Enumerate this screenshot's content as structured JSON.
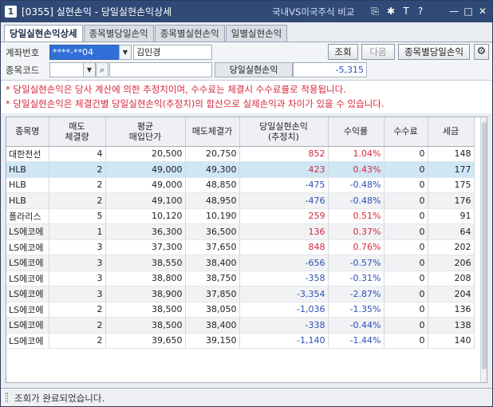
{
  "window": {
    "screen_no": "[0355]",
    "title": "실현손익 - 당일실현손익상세",
    "link": "국내VS미국주식 비교",
    "app_icon": "1"
  },
  "titlebar_icons": [
    "link-icon",
    "pin-icon",
    "font-size-icon",
    "help-icon",
    "minimize-icon",
    "maximize-icon",
    "close-icon"
  ],
  "tabs": [
    {
      "label": "당일실현손익상세",
      "active": true
    },
    {
      "label": "종목별당일손익",
      "active": false
    },
    {
      "label": "종목별실현손익",
      "active": false
    },
    {
      "label": "일별실현손익",
      "active": false
    }
  ],
  "form": {
    "account_label": "계좌번호",
    "account_value": "****-**04",
    "account_name": "김인경",
    "stock_label": "종목코드",
    "stock_value": "",
    "stock_name": "",
    "summary_label": "당일실현손익",
    "summary_value": "-5,315",
    "query_button": "조회",
    "next_button": "다음",
    "stock_daily_button": "종목별당일손익"
  },
  "notes": [
    "* 당일실현손익은 당사 계산에 의한 추정치이며, 수수료는 체결시 수수료률로 적용됩니다.",
    "* 당일실현손익은 체결건별 당일실현손익(추정치)의 합산으로 실제손익과 차이가 있을 수 있습니다."
  ],
  "table": {
    "headers": {
      "name": "종목명",
      "qty_1": "매도",
      "qty_2": "체결량",
      "avg_1": "평균",
      "avg_2": "매입단가",
      "sell_price": "매도체결가",
      "pnl_1": "당일실현손익",
      "pnl_2": "(추정치)",
      "rate": "수익률",
      "fee": "수수료",
      "tax": "세금"
    },
    "rows": [
      {
        "name": "대한전선",
        "qty": "4",
        "avg": "20,500",
        "sell": "20,750",
        "pnl": "852",
        "rate": "1.04%",
        "fee": "0",
        "tax": "148",
        "sign": "pos"
      },
      {
        "name": "HLB",
        "qty": "2",
        "avg": "49,000",
        "sell": "49,300",
        "pnl": "423",
        "rate": "0.43%",
        "fee": "0",
        "tax": "177",
        "sign": "pos"
      },
      {
        "name": "HLB",
        "qty": "2",
        "avg": "49,000",
        "sell": "48,850",
        "pnl": "-475",
        "rate": "-0.48%",
        "fee": "0",
        "tax": "175",
        "sign": "neg"
      },
      {
        "name": "HLB",
        "qty": "2",
        "avg": "49,100",
        "sell": "48,950",
        "pnl": "-476",
        "rate": "-0.48%",
        "fee": "0",
        "tax": "176",
        "sign": "neg"
      },
      {
        "name": "폴라리스",
        "qty": "5",
        "avg": "10,120",
        "sell": "10,190",
        "pnl": "259",
        "rate": "0.51%",
        "fee": "0",
        "tax": "91",
        "sign": "pos"
      },
      {
        "name": "LS에코에",
        "qty": "1",
        "avg": "36,300",
        "sell": "36,500",
        "pnl": "136",
        "rate": "0.37%",
        "fee": "0",
        "tax": "64",
        "sign": "pos"
      },
      {
        "name": "LS에코에",
        "qty": "3",
        "avg": "37,300",
        "sell": "37,650",
        "pnl": "848",
        "rate": "0.76%",
        "fee": "0",
        "tax": "202",
        "sign": "pos"
      },
      {
        "name": "LS에코에",
        "qty": "3",
        "avg": "38,550",
        "sell": "38,400",
        "pnl": "-656",
        "rate": "-0.57%",
        "fee": "0",
        "tax": "206",
        "sign": "neg"
      },
      {
        "name": "LS에코에",
        "qty": "3",
        "avg": "38,800",
        "sell": "38,750",
        "pnl": "-358",
        "rate": "-0.31%",
        "fee": "0",
        "tax": "208",
        "sign": "neg"
      },
      {
        "name": "LS에코에",
        "qty": "3",
        "avg": "38,900",
        "sell": "37,850",
        "pnl": "-3,354",
        "rate": "-2.87%",
        "fee": "0",
        "tax": "204",
        "sign": "neg"
      },
      {
        "name": "LS에코에",
        "qty": "2",
        "avg": "38,500",
        "sell": "38,050",
        "pnl": "-1,036",
        "rate": "-1.35%",
        "fee": "0",
        "tax": "136",
        "sign": "neg"
      },
      {
        "name": "LS에코에",
        "qty": "2",
        "avg": "38,500",
        "sell": "38,400",
        "pnl": "-338",
        "rate": "-0.44%",
        "fee": "0",
        "tax": "138",
        "sign": "neg"
      },
      {
        "name": "LS에코에",
        "qty": "2",
        "avg": "39,650",
        "sell": "39,150",
        "pnl": "-1,140",
        "rate": "-1.44%",
        "fee": "0",
        "tax": "140",
        "sign": "neg"
      }
    ]
  },
  "status": {
    "message": "조회가 완료되었습니다."
  },
  "colors": {
    "positive": "#d7263d",
    "negative": "#2a4fb8",
    "selected_row": "#cfe6f5",
    "titlebar": "#2f4a77"
  }
}
